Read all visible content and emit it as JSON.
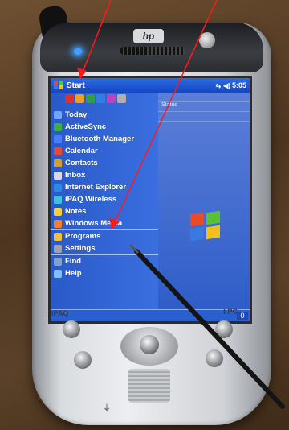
{
  "device": {
    "logo": "hp",
    "left_label": "iPAQ",
    "right_label": "t PC"
  },
  "screen": {
    "title": "Start",
    "clock": "5:05",
    "right_pane": [
      "",
      "Status",
      ""
    ],
    "menu_items": [
      {
        "label": "Today",
        "color": "#6fa8ff"
      },
      {
        "label": "ActiveSync",
        "color": "#3ab04a"
      },
      {
        "label": "Bluetooth Manager",
        "color": "#4a7cff"
      },
      {
        "label": "Calendar",
        "color": "#e04a3a"
      },
      {
        "label": "Contacts",
        "color": "#c8a040"
      },
      {
        "label": "Inbox",
        "color": "#d8d8f0"
      },
      {
        "label": "Internet Explorer",
        "color": "#2a8ae0"
      },
      {
        "label": "iPAQ Wireless",
        "color": "#40c0e0"
      },
      {
        "label": "Notes",
        "color": "#f0d040"
      },
      {
        "label": "Windows Media",
        "color": "#f08030"
      },
      {
        "label": "Programs",
        "color": "#f0c040",
        "separator": true
      },
      {
        "label": "Settings",
        "color": "#a0a0b0"
      },
      {
        "label": "Find",
        "color": "#80a0d0",
        "separator": true
      },
      {
        "label": "Help",
        "color": "#80c0ff"
      }
    ],
    "quick_icons": [
      "#e03030",
      "#f0a020",
      "#30a040",
      "#3080e0",
      "#c040c0",
      "#b0b0b0"
    ],
    "keyboard_glyph": "0",
    "win_colors": [
      "#e84a2a",
      "#5ac03a",
      "#3a7ae0",
      "#f0c020"
    ]
  },
  "annotations": {
    "arrow_color": "#ff1a1a",
    "stylus_color": "#141414"
  }
}
